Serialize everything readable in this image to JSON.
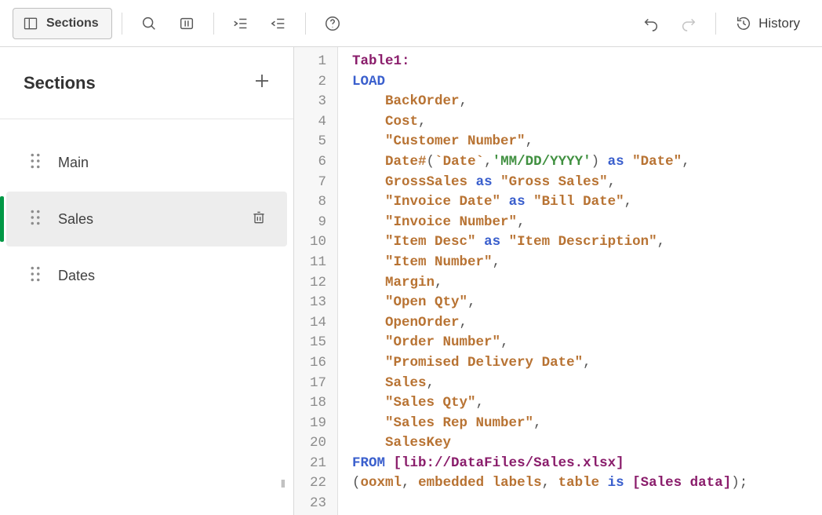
{
  "toolbar": {
    "sections_label": "Sections",
    "history_label": "History"
  },
  "sidebar": {
    "title": "Sections",
    "items": [
      {
        "label": "Main",
        "active": false
      },
      {
        "label": "Sales",
        "active": true
      },
      {
        "label": "Dates",
        "active": false
      }
    ]
  },
  "editor": {
    "line_count": 23,
    "code_lines": [
      [
        {
          "c": "tk-label",
          "t": "Table1:"
        }
      ],
      [
        {
          "c": "tk-kw",
          "t": "LOAD"
        }
      ],
      [
        {
          "c": "",
          "t": "    "
        },
        {
          "c": "tk-ident",
          "t": "BackOrder"
        },
        {
          "c": "tk-punc",
          "t": ","
        }
      ],
      [
        {
          "c": "",
          "t": "    "
        },
        {
          "c": "tk-ident",
          "t": "Cost"
        },
        {
          "c": "tk-punc",
          "t": ","
        }
      ],
      [
        {
          "c": "",
          "t": "    "
        },
        {
          "c": "tk-str",
          "t": "\"Customer Number\""
        },
        {
          "c": "tk-punc",
          "t": ","
        }
      ],
      [
        {
          "c": "",
          "t": "    "
        },
        {
          "c": "tk-func",
          "t": "Date#"
        },
        {
          "c": "tk-punc",
          "t": "("
        },
        {
          "c": "tk-ident",
          "t": "`Date`"
        },
        {
          "c": "tk-punc",
          "t": ","
        },
        {
          "c": "tk-lit",
          "t": "'MM/DD/YYYY'"
        },
        {
          "c": "tk-punc",
          "t": ") "
        },
        {
          "c": "tk-kw",
          "t": "as"
        },
        {
          "c": "",
          "t": " "
        },
        {
          "c": "tk-str",
          "t": "\"Date\""
        },
        {
          "c": "tk-punc",
          "t": ","
        }
      ],
      [
        {
          "c": "",
          "t": "    "
        },
        {
          "c": "tk-ident",
          "t": "GrossSales"
        },
        {
          "c": "",
          "t": " "
        },
        {
          "c": "tk-kw",
          "t": "as"
        },
        {
          "c": "",
          "t": " "
        },
        {
          "c": "tk-str",
          "t": "\"Gross Sales\""
        },
        {
          "c": "tk-punc",
          "t": ","
        }
      ],
      [
        {
          "c": "",
          "t": "    "
        },
        {
          "c": "tk-str",
          "t": "\"Invoice Date\""
        },
        {
          "c": "",
          "t": " "
        },
        {
          "c": "tk-kw",
          "t": "as"
        },
        {
          "c": "",
          "t": " "
        },
        {
          "c": "tk-str",
          "t": "\"Bill Date\""
        },
        {
          "c": "tk-punc",
          "t": ","
        }
      ],
      [
        {
          "c": "",
          "t": "    "
        },
        {
          "c": "tk-str",
          "t": "\"Invoice Number\""
        },
        {
          "c": "tk-punc",
          "t": ","
        }
      ],
      [
        {
          "c": "",
          "t": "    "
        },
        {
          "c": "tk-str",
          "t": "\"Item Desc\""
        },
        {
          "c": "",
          "t": " "
        },
        {
          "c": "tk-kw",
          "t": "as"
        },
        {
          "c": "",
          "t": " "
        },
        {
          "c": "tk-str",
          "t": "\"Item Description\""
        },
        {
          "c": "tk-punc",
          "t": ","
        }
      ],
      [
        {
          "c": "",
          "t": "    "
        },
        {
          "c": "tk-str",
          "t": "\"Item Number\""
        },
        {
          "c": "tk-punc",
          "t": ","
        }
      ],
      [
        {
          "c": "",
          "t": "    "
        },
        {
          "c": "tk-ident",
          "t": "Margin"
        },
        {
          "c": "tk-punc",
          "t": ","
        }
      ],
      [
        {
          "c": "",
          "t": "    "
        },
        {
          "c": "tk-str",
          "t": "\"Open Qty\""
        },
        {
          "c": "tk-punc",
          "t": ","
        }
      ],
      [
        {
          "c": "",
          "t": "    "
        },
        {
          "c": "tk-ident",
          "t": "OpenOrder"
        },
        {
          "c": "tk-punc",
          "t": ","
        }
      ],
      [
        {
          "c": "",
          "t": "    "
        },
        {
          "c": "tk-str",
          "t": "\"Order Number\""
        },
        {
          "c": "tk-punc",
          "t": ","
        }
      ],
      [
        {
          "c": "",
          "t": "    "
        },
        {
          "c": "tk-str",
          "t": "\"Promised Delivery Date\""
        },
        {
          "c": "tk-punc",
          "t": ","
        }
      ],
      [
        {
          "c": "",
          "t": "    "
        },
        {
          "c": "tk-ident",
          "t": "Sales"
        },
        {
          "c": "tk-punc",
          "t": ","
        }
      ],
      [
        {
          "c": "",
          "t": "    "
        },
        {
          "c": "tk-str",
          "t": "\"Sales Qty\""
        },
        {
          "c": "tk-punc",
          "t": ","
        }
      ],
      [
        {
          "c": "",
          "t": "    "
        },
        {
          "c": "tk-str",
          "t": "\"Sales Rep Number\""
        },
        {
          "c": "tk-punc",
          "t": ","
        }
      ],
      [
        {
          "c": "",
          "t": "    "
        },
        {
          "c": "tk-ident",
          "t": "SalesKey"
        }
      ],
      [
        {
          "c": "tk-kw",
          "t": "FROM"
        },
        {
          "c": "",
          "t": " "
        },
        {
          "c": "tk-brk",
          "t": "[lib://DataFiles/Sales.xlsx]"
        }
      ],
      [
        {
          "c": "tk-punc",
          "t": "("
        },
        {
          "c": "tk-ident",
          "t": "ooxml"
        },
        {
          "c": "tk-punc",
          "t": ", "
        },
        {
          "c": "tk-ident",
          "t": "embedded labels"
        },
        {
          "c": "tk-punc",
          "t": ", "
        },
        {
          "c": "tk-ident",
          "t": "table"
        },
        {
          "c": "",
          "t": " "
        },
        {
          "c": "tk-kw",
          "t": "is"
        },
        {
          "c": "",
          "t": " "
        },
        {
          "c": "tk-brk",
          "t": "[Sales data]"
        },
        {
          "c": "tk-punc",
          "t": ");"
        }
      ],
      []
    ]
  }
}
